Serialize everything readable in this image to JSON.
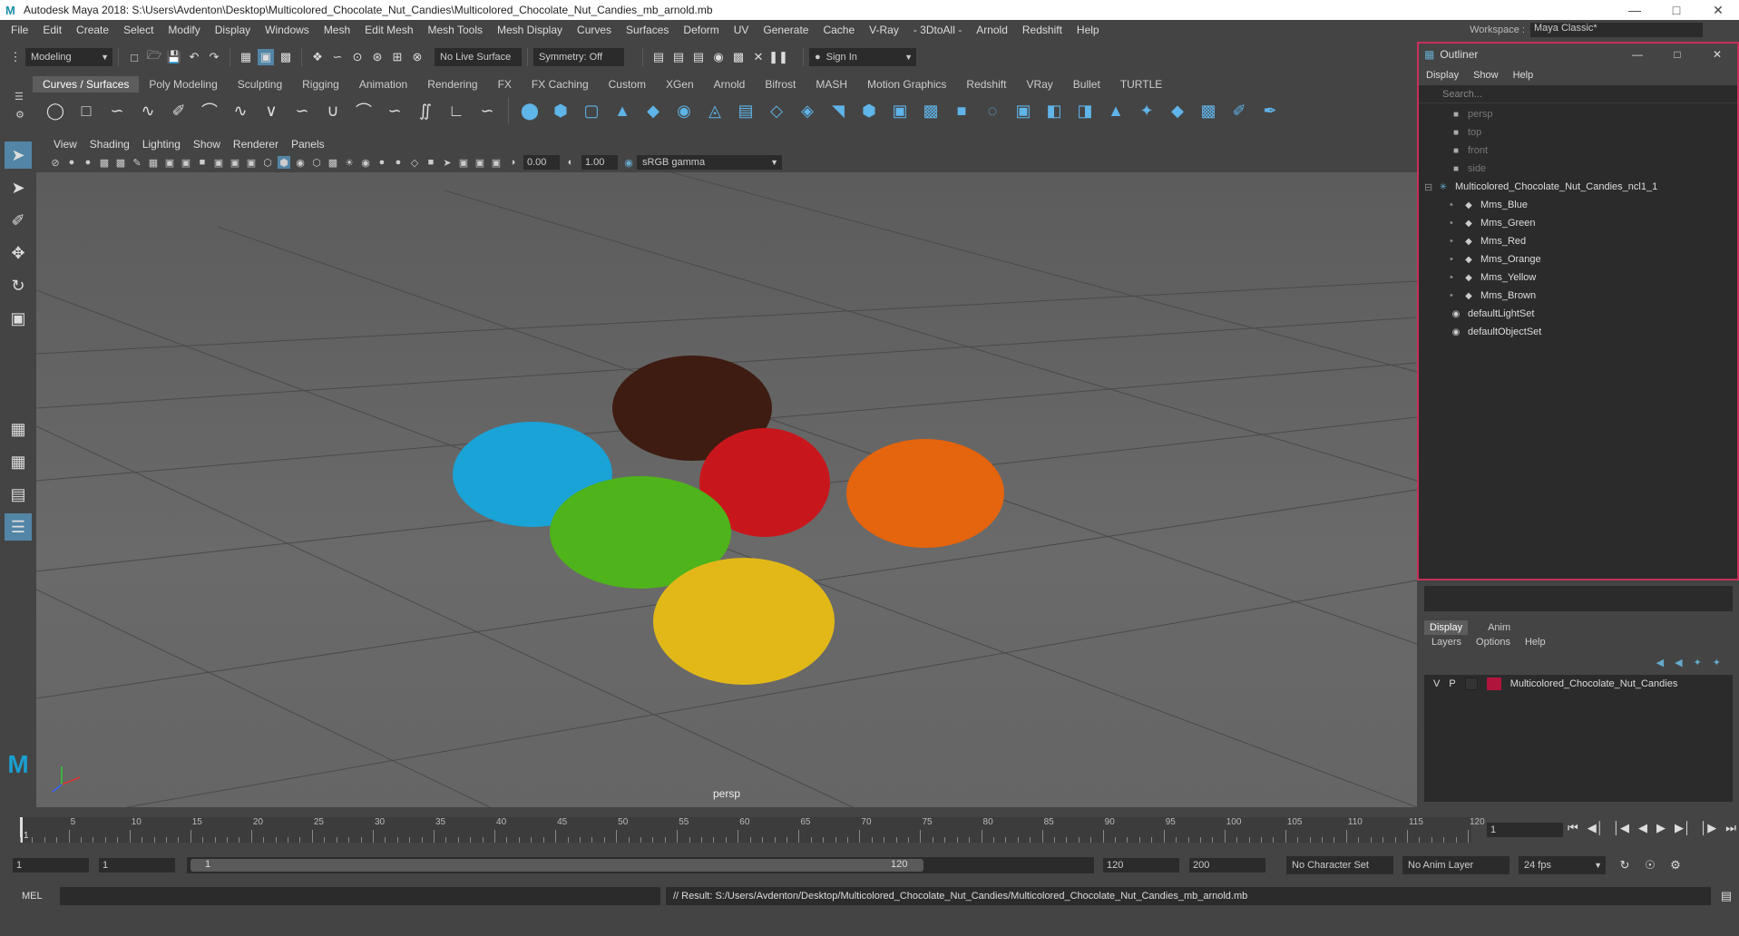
{
  "title_bar": {
    "text": "Autodesk Maya 2018: S:\\Users\\Avdenton\\Desktop\\Multicolored_Chocolate_Nut_Candies\\Multicolored_Chocolate_Nut_Candies_mb_arnold.mb"
  },
  "menubar": {
    "items": [
      "File",
      "Edit",
      "Create",
      "Select",
      "Modify",
      "Display",
      "Windows",
      "Mesh",
      "Edit Mesh",
      "Mesh Tools",
      "Mesh Display",
      "Curves",
      "Surfaces",
      "Deform",
      "UV",
      "Generate",
      "Cache",
      "V-Ray",
      "- 3DtoAll -",
      "Arnold",
      "Redshift",
      "Help"
    ],
    "workspace_label": "Workspace :",
    "workspace_value": "Maya Classic*"
  },
  "status_line": {
    "mode": "Modeling",
    "live_surface": "No Live Surface",
    "symmetry": "Symmetry: Off",
    "sign_in": "Sign In"
  },
  "shelf": {
    "tabs": [
      "Curves / Surfaces",
      "Poly Modeling",
      "Sculpting",
      "Rigging",
      "Animation",
      "Rendering",
      "FX",
      "FX Caching",
      "Custom",
      "XGen",
      "Arnold",
      "Bifrost",
      "MASH",
      "Motion Graphics",
      "Redshift",
      "VRay",
      "Bullet",
      "TURTLE"
    ],
    "active_tab": "Curves / Surfaces"
  },
  "viewport": {
    "menu": [
      "View",
      "Shading",
      "Lighting",
      "Show",
      "Renderer",
      "Panels"
    ],
    "exposure": "0.00",
    "gamma": "1.00",
    "color_space": "sRGB gamma",
    "camera_label": "persp"
  },
  "outliner": {
    "title": "Outliner",
    "menu": [
      "Display",
      "Show",
      "Help"
    ],
    "search_placeholder": "Search...",
    "items": [
      {
        "label": "persp",
        "dim": true,
        "indent": 1,
        "icon": "camera-icon"
      },
      {
        "label": "top",
        "dim": true,
        "indent": 1,
        "icon": "camera-icon"
      },
      {
        "label": "front",
        "dim": true,
        "indent": 1,
        "icon": "camera-icon"
      },
      {
        "label": "side",
        "dim": true,
        "indent": 1,
        "icon": "camera-icon"
      },
      {
        "label": "Multicolored_Chocolate_Nut_Candies_ncl1_1",
        "dim": false,
        "indent": 0,
        "icon": "group-icon"
      },
      {
        "label": "Mms_Blue",
        "dim": false,
        "indent": 2,
        "icon": "mesh-icon"
      },
      {
        "label": "Mms_Green",
        "dim": false,
        "indent": 2,
        "icon": "mesh-icon"
      },
      {
        "label": "Mms_Red",
        "dim": false,
        "indent": 2,
        "icon": "mesh-icon"
      },
      {
        "label": "Mms_Orange",
        "dim": false,
        "indent": 2,
        "icon": "mesh-icon"
      },
      {
        "label": "Mms_Yellow",
        "dim": false,
        "indent": 2,
        "icon": "mesh-icon"
      },
      {
        "label": "Mms_Brown",
        "dim": false,
        "indent": 2,
        "icon": "mesh-icon"
      },
      {
        "label": "defaultLightSet",
        "dim": false,
        "indent": 1,
        "icon": "set-icon"
      },
      {
        "label": "defaultObjectSet",
        "dim": false,
        "indent": 1,
        "icon": "set-icon"
      }
    ]
  },
  "layer_editor": {
    "tabs": [
      "Display",
      "Anim"
    ],
    "menu": [
      "Layers",
      "Options",
      "Help"
    ],
    "layer": {
      "v": "V",
      "p": "P",
      "name": "Multicolored_Chocolate_Nut_Candies",
      "color": "#b0143c"
    }
  },
  "timeline": {
    "ticks": [
      "5",
      "10",
      "15",
      "20",
      "25",
      "30",
      "35",
      "40",
      "45",
      "50",
      "55",
      "60",
      "65",
      "70",
      "75",
      "80",
      "85",
      "90",
      "95",
      "100",
      "105",
      "110",
      "115",
      "120"
    ],
    "start_marker": "1",
    "current_frame": "1"
  },
  "range": {
    "start": "1",
    "playback_start": "1",
    "slider_start": "1",
    "slider_end": "120",
    "playback_end": "120",
    "end": "200",
    "character_set": "No Character Set",
    "anim_layer": "No Anim Layer",
    "fps": "24 fps"
  },
  "command_line": {
    "label": "MEL",
    "result": "// Result: S:/Users/Avdenton/Desktop/Multicolored_Chocolate_Nut_Candies/Multicolored_Chocolate_Nut_Candies_mb_arnold.mb"
  }
}
